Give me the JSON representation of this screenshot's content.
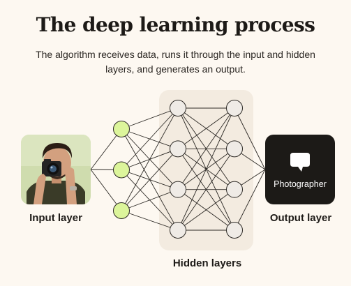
{
  "header": {
    "title": "The deep learning process",
    "subtitle": "The algorithm receives data, runs it through the input and hidden layers, and generates an output."
  },
  "labels": {
    "input": "Input layer",
    "hidden": "Hidden layers",
    "output": "Output layer"
  },
  "output": {
    "text": "Photographer",
    "icon": "speech-bubble-icon"
  },
  "input": {
    "image": "photographer-photo"
  },
  "network": {
    "layers": [
      3,
      4,
      4
    ]
  },
  "colors": {
    "background": "#fdf8f1",
    "hidden_panel": "#f3ebe0",
    "input_node": "#dcf59b",
    "hidden_node": "#efebe6",
    "output_box": "#1c1a17",
    "line": "#2c2925"
  }
}
